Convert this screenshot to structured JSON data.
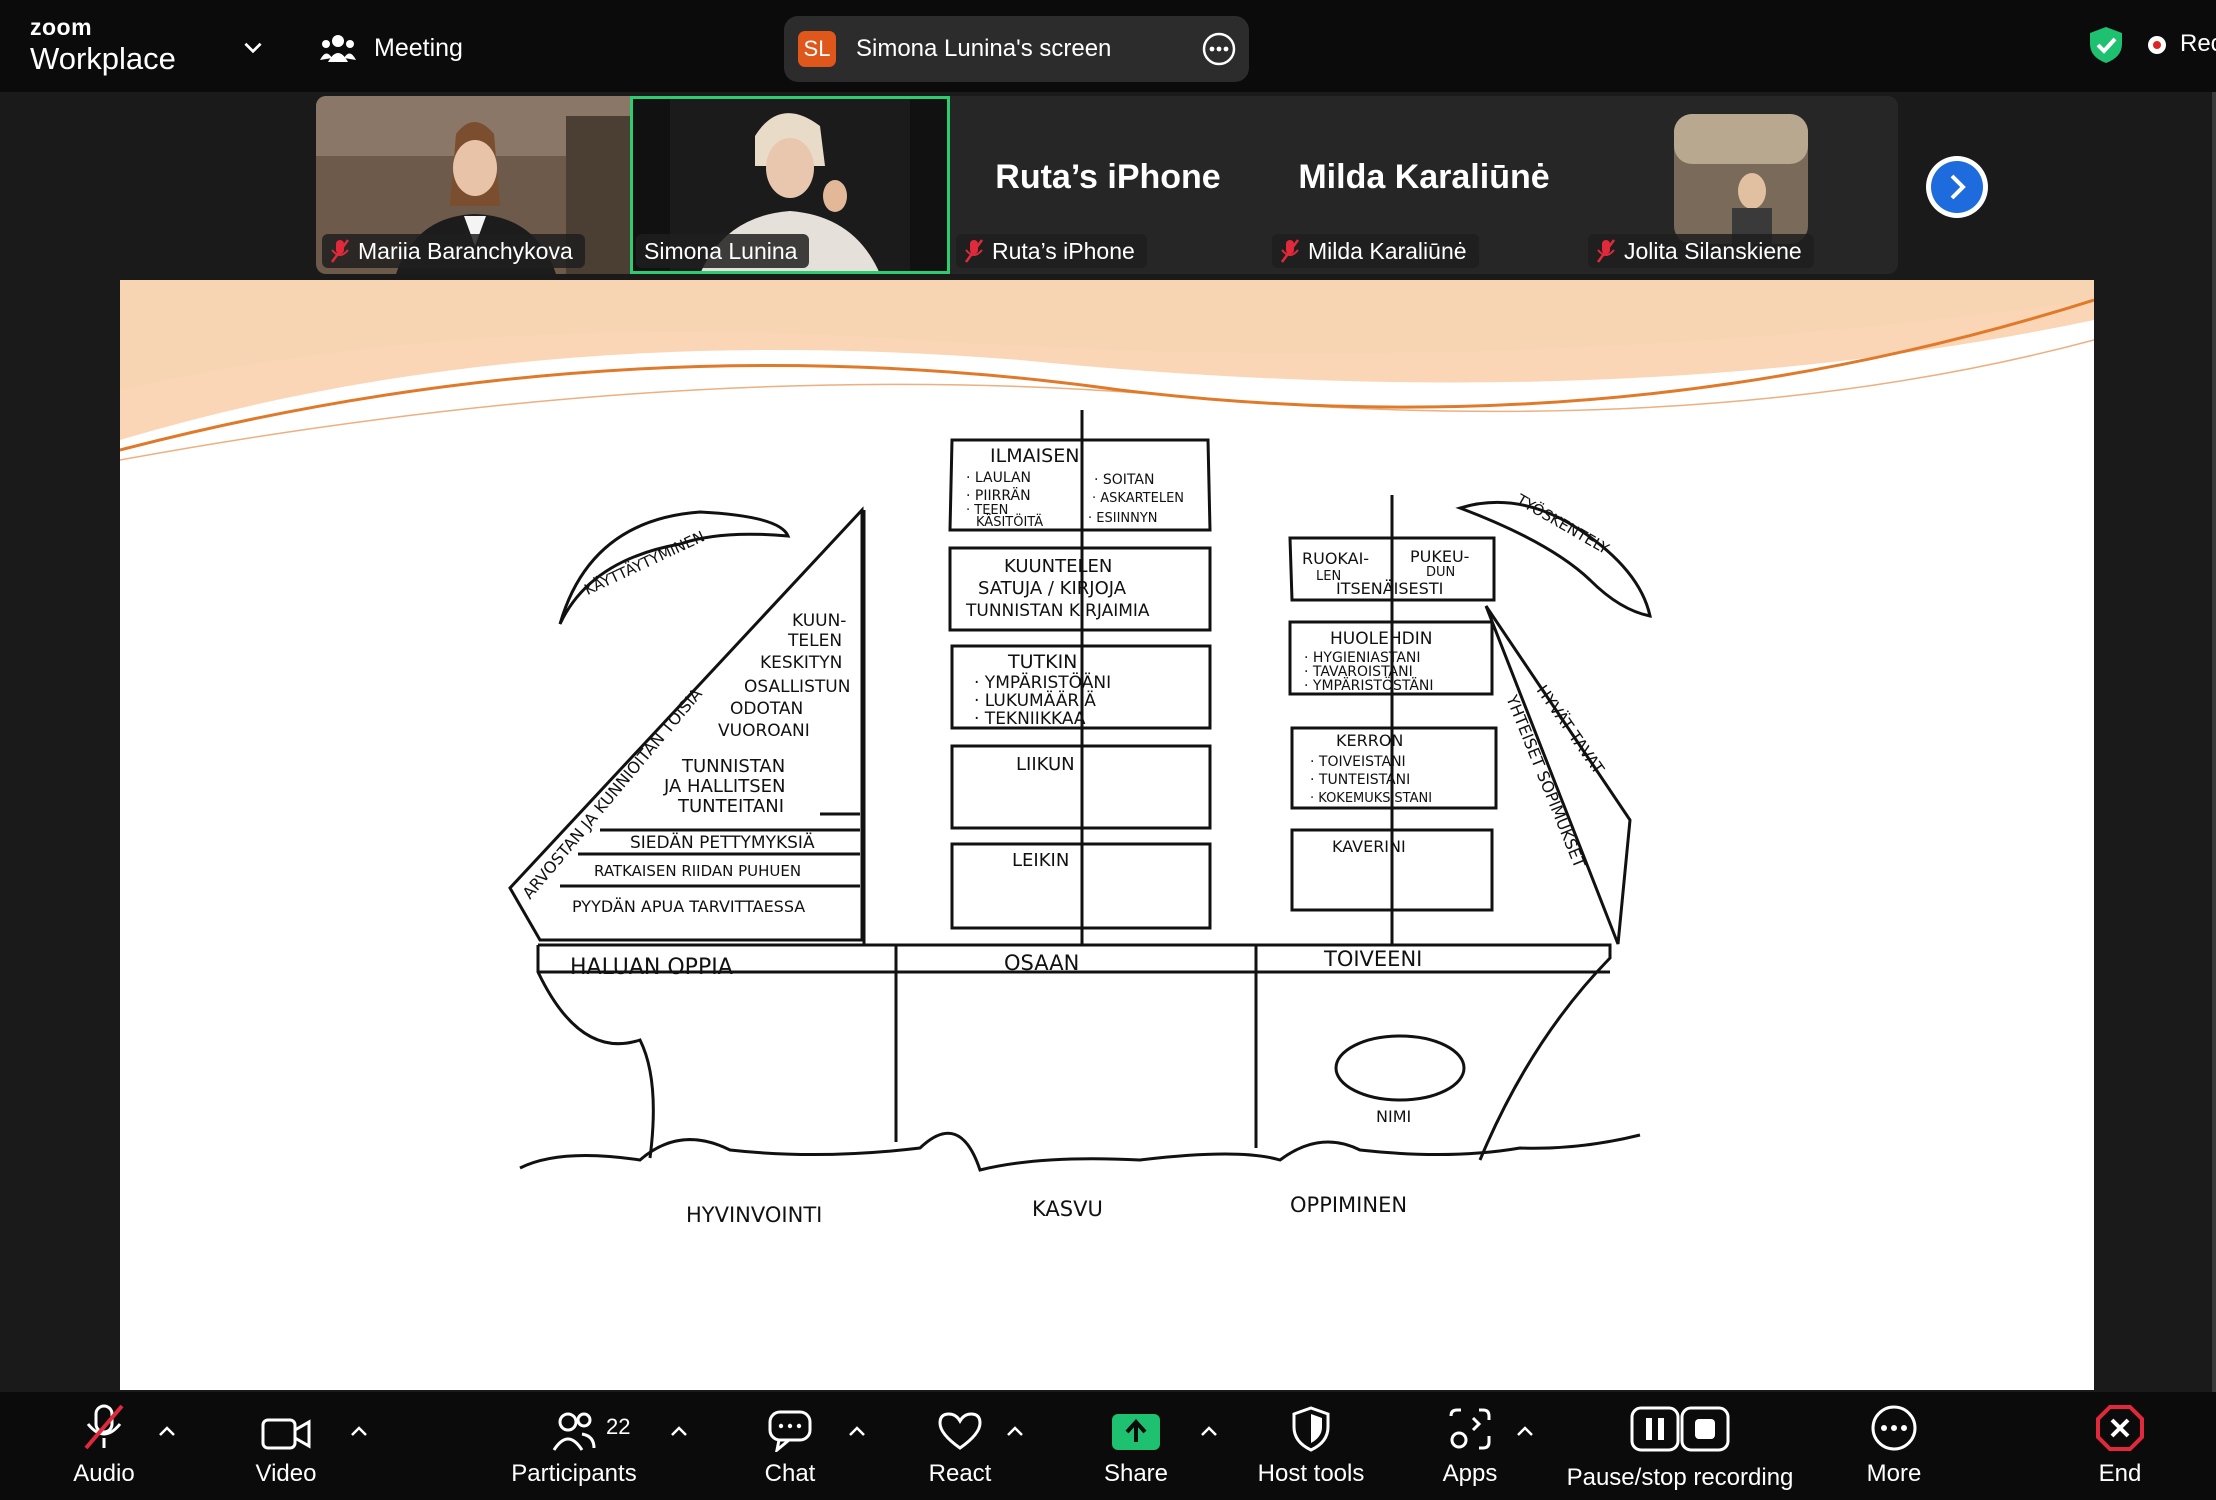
{
  "top_bar": {
    "brand_small": "zoom",
    "brand_big": "Workplace",
    "meeting_label": "Meeting",
    "share_badge": "SL",
    "share_title": "Simona Lunina's screen",
    "recording_label": "Rec"
  },
  "participants": [
    {
      "name": "Mariia Baranchykova",
      "muted": true,
      "has_video": true
    },
    {
      "name": "Simona Lunina",
      "muted": false,
      "has_video": true,
      "active_speaker": true
    },
    {
      "name": "Ruta’s iPhone",
      "muted": true,
      "has_video": false
    },
    {
      "name": "Milda Karaliūnė",
      "muted": true,
      "has_video": false
    },
    {
      "name": "Jolita Silanskiene",
      "muted": true,
      "has_video": true
    }
  ],
  "slide": {
    "bird_left": "KÄYTTÄYTYMINEN",
    "bird_right": "TYÖSKENTELY",
    "left_sail_edge": "ARVOSTAN JA KUNNIOITAN TOISIA",
    "left_sail_lines": [
      "KUUN-",
      "TELEN",
      "KESKITYN",
      "OSALLISTUN",
      "ODOTAN",
      "VUOROANI",
      "TUNNISTAN",
      "JA HALLITSEN",
      "TUNTEITANI",
      "SIEDÄN PETTYMYKSIÄ",
      "RATKAISEN RIIDAN PUHUEN",
      "PYYDÄN APUA TARVITTAESSA"
    ],
    "mid_sails": [
      [
        "ILMAISEN",
        "· LAULAN",
        "· SOITAN",
        "· PIIRRÄN",
        "· ASKARTELEN",
        "· TEEN",
        "KÄSITÖITÄ",
        "· ESIINNYN"
      ],
      [
        "KUUNTELEN",
        "SATUJA / KIRJOJA",
        "TUNNISTAN KIRJAIMIA"
      ],
      [
        "TUTKIN",
        "· YMPÄRISTÖÄNI",
        "· LUKUMÄÄRIÄ",
        "· TEKNIIKKAA"
      ],
      [
        "LIIKUN"
      ],
      [
        "LEIKIN"
      ]
    ],
    "right_sails": [
      [
        "RUOKAI-",
        "LEN",
        "PUKEU-",
        "DUN",
        "ITSENÄISESTI"
      ],
      [
        "HUOLEHDIN",
        "· HYGIENIASTANI",
        "· TAVAROISTANI",
        "· YMPÄRISTÖSTÄNI"
      ],
      [
        "KERRON",
        "· TOIVEISTANI",
        "· TUNTEISTANI",
        "· KOKEMUKSISTANI"
      ],
      [
        "KAVERINI"
      ]
    ],
    "right_sail_edge": [
      "HYVÄT TAVAT",
      "YHTEISET SOPIMUKSET"
    ],
    "deck_labels": [
      "HALUAN OPPIA",
      "OSAAN",
      "TOIVEENI"
    ],
    "name_label": "NIMI",
    "bottom_labels": [
      "HYVINVOINTI",
      "KASVU",
      "OPPIMINEN"
    ]
  },
  "toolbar": {
    "audio": "Audio",
    "video": "Video",
    "participants": "Participants",
    "participant_count": "22",
    "chat": "Chat",
    "react": "React",
    "share": "Share",
    "host_tools": "Host tools",
    "apps": "Apps",
    "recording": "Pause/stop recording",
    "more": "More",
    "end": "End"
  },
  "colors": {
    "share_green": "#1ec16f",
    "active_border": "#2ecc71",
    "badge_orange": "#e0571b",
    "end_red": "#e02a3b",
    "next_blue": "#1e6bde"
  }
}
